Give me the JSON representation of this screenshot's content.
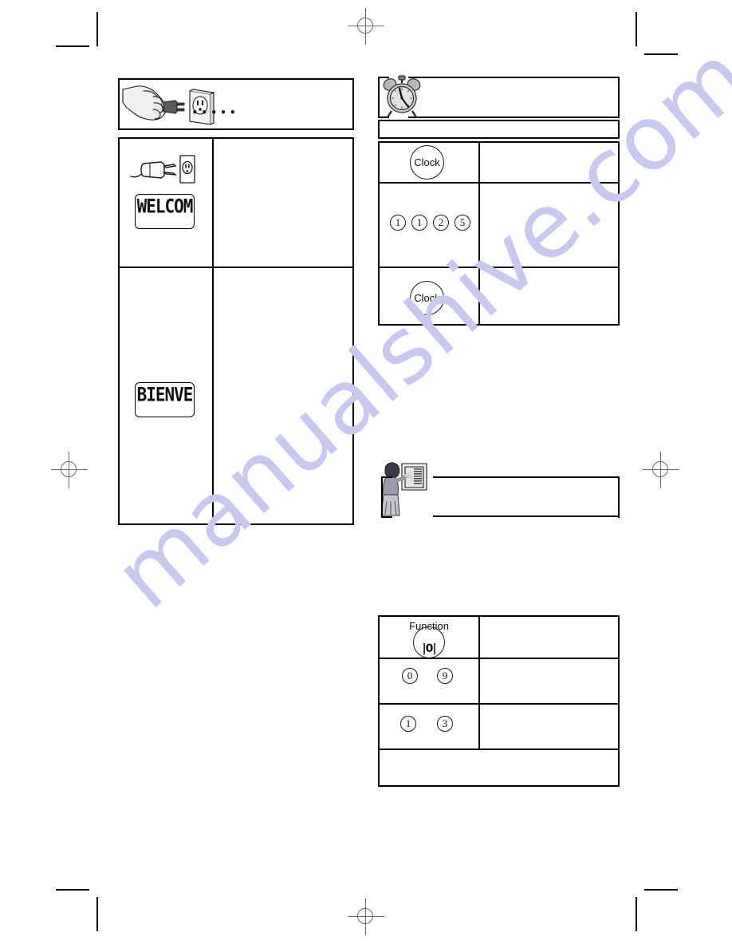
{
  "document": {
    "type": "scanned-manual-page",
    "watermark": "manualshive.com",
    "watermark_color": "#c9c9ef",
    "background_color": "#ffffff",
    "ink_color": "#000000"
  },
  "left_column": {
    "plug_notice_box": {
      "illustration": "hand-inserting-plug-into-wall-outlet",
      "trailing_dots": "• • • • •"
    },
    "steps_table": {
      "rows": [
        {
          "icon": "power-plug-and-outlet",
          "display": {
            "lcd_text": "WELCOM",
            "label": "lcd-display-welcome"
          },
          "description": ""
        },
        {
          "icon": "",
          "display": {
            "lcd_text": "BIENVE",
            "label": "lcd-display-bienvenue"
          },
          "description": ""
        }
      ]
    }
  },
  "right_column": {
    "clock_section": {
      "icon": "alarm-clock-icon",
      "heading": "",
      "subheading": "",
      "steps_table": {
        "rows": [
          {
            "keys": [
              {
                "type": "word",
                "label": "Clock",
                "name": "clock-key"
              }
            ],
            "description": ""
          },
          {
            "keys": [
              {
                "type": "number",
                "label": "1",
                "name": "number-key-1"
              },
              {
                "type": "number",
                "label": "1",
                "name": "number-key-1"
              },
              {
                "type": "number",
                "label": "2",
                "name": "number-key-2"
              },
              {
                "type": "number",
                "label": "5",
                "name": "number-key-5"
              }
            ],
            "description": ""
          },
          {
            "keys": [
              {
                "type": "word",
                "label": "Clock",
                "name": "clock-key"
              }
            ],
            "description": ""
          }
        ]
      }
    },
    "function_section": {
      "icon": "person-reading-manual-icon",
      "heading": "",
      "subheading": "",
      "steps_table": {
        "rows": [
          {
            "keys": [
              {
                "type": "function",
                "label": "Function",
                "glyph": "|0|",
                "name": "function-key"
              }
            ],
            "description": ""
          },
          {
            "keys": [
              {
                "type": "number",
                "label": "0",
                "name": "number-key-0"
              },
              {
                "type": "number",
                "label": "9",
                "name": "number-key-9"
              }
            ],
            "description": ""
          },
          {
            "keys": [
              {
                "type": "number",
                "label": "1",
                "name": "number-key-1"
              },
              {
                "type": "number",
                "label": "3",
                "name": "number-key-3"
              }
            ],
            "description": ""
          },
          {
            "keys": [],
            "description": ""
          }
        ]
      }
    }
  }
}
